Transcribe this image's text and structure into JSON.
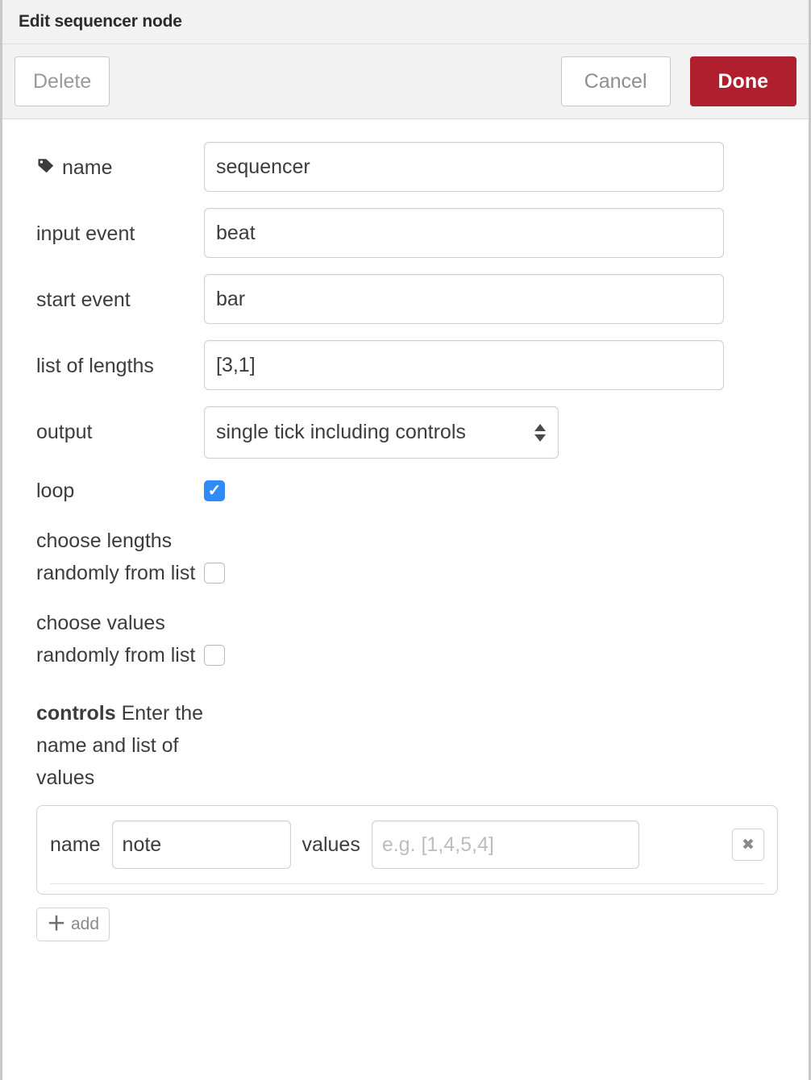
{
  "titlebar": {
    "title": "Edit sequencer node"
  },
  "actions": {
    "delete_label": "Delete",
    "cancel_label": "Cancel",
    "done_label": "Done",
    "done_color": "#b01f2e"
  },
  "form": {
    "name": {
      "label": "name",
      "icon": "tag-icon",
      "value": "sequencer"
    },
    "input_event": {
      "label": "input event",
      "value": "beat"
    },
    "start_event": {
      "label": "start event",
      "value": "bar"
    },
    "list_of_lengths": {
      "label": "list of lengths",
      "value": "[3,1]"
    },
    "output": {
      "label": "output",
      "value": "single tick including controls"
    },
    "loop": {
      "label": "loop",
      "checked": true
    },
    "choose_lengths_randomly": {
      "label": "choose lengths randomly from list",
      "checked": false
    },
    "choose_values_randomly": {
      "label": "choose values randomly from list",
      "checked": false
    }
  },
  "controls": {
    "heading": "controls",
    "description": " Enter the name and list of values",
    "row": {
      "name_label": "name",
      "name_value": "note",
      "values_label": "values",
      "values_placeholder": "e.g. [1,4,5,4]",
      "remove_label": "✖"
    },
    "add_label": "add",
    "add_icon": "＋"
  },
  "colors": {
    "accent_checkbox": "#2f8bf5",
    "chrome_bg": "#f2f2f2",
    "border": "#cfcfcf"
  }
}
